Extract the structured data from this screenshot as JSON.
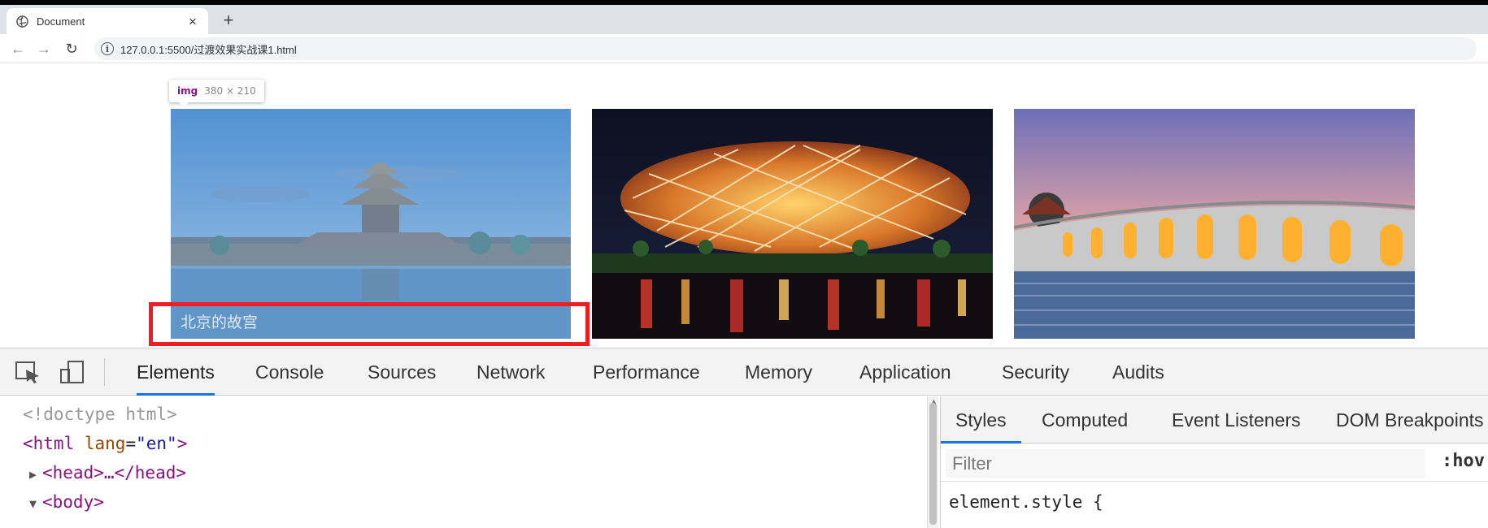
{
  "browser": {
    "tab": {
      "title": "Document",
      "close_glyph": "×",
      "favicon": "globe-icon"
    },
    "new_tab_glyph": "+",
    "nav": {
      "back": "←",
      "forward": "→",
      "reload": "↻"
    },
    "url": "127.0.0.1:5500/过渡效果实战课1.html",
    "info_glyph": "i"
  },
  "page": {
    "inspect_tooltip": {
      "tag": "img",
      "size": "380 × 210"
    },
    "images": [
      {
        "name": "forbidden-city",
        "caption": "北京的故宫"
      },
      {
        "name": "birds-nest-stadium"
      },
      {
        "name": "seventeen-arch-bridge"
      }
    ],
    "highlight_color": "#6fa8dc",
    "red_box_color": "#ee1c25"
  },
  "devtools": {
    "tabs": [
      "Elements",
      "Console",
      "Sources",
      "Network",
      "Performance",
      "Memory",
      "Application",
      "Security",
      "Audits"
    ],
    "active_tab": "Elements",
    "dom_lines": {
      "doctype": "<!doctype html>",
      "html_open": "<html",
      "html_attr": "lang",
      "html_eq": "=",
      "html_val": "\"en\"",
      "html_close": ">",
      "head": "<head>…</head>",
      "body": "<body>"
    },
    "styles_tabs": [
      "Styles",
      "Computed",
      "Event Listeners",
      "DOM Breakpoints"
    ],
    "filter_placeholder": "Filter",
    "hov_label": ":hov",
    "element_style": "element.style {"
  }
}
